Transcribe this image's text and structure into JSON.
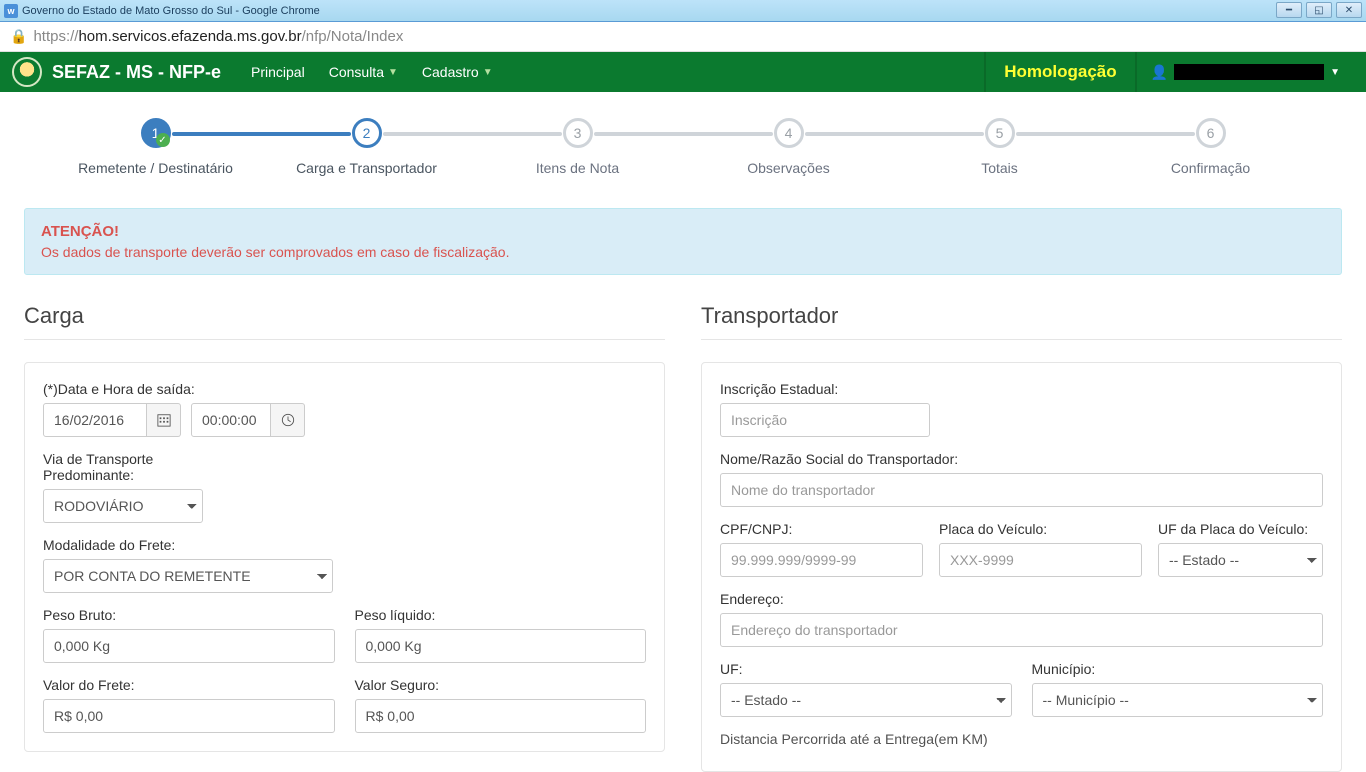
{
  "window": {
    "title": "Governo do Estado de Mato Grosso do Sul - Google Chrome",
    "url_full": "https://hom.servicos.efazenda.ms.gov.br/nfp/Nota/Index",
    "url_scheme": "https://",
    "url_host": "hom.servicos.efazenda.ms.gov.br",
    "url_path": "/nfp/Nota/Index"
  },
  "nav": {
    "brand": "SEFAZ - MS - NFP-e",
    "links": [
      "Principal",
      "Consulta",
      "Cadastro"
    ],
    "env_badge": "Homologação"
  },
  "wizard": {
    "steps": [
      {
        "num": "1",
        "label": "Remetente / Destinatário"
      },
      {
        "num": "2",
        "label": "Carga e Transportador"
      },
      {
        "num": "3",
        "label": "Itens de Nota"
      },
      {
        "num": "4",
        "label": "Observações"
      },
      {
        "num": "5",
        "label": "Totais"
      },
      {
        "num": "6",
        "label": "Confirmação"
      }
    ]
  },
  "alert": {
    "title": "ATENÇÃO!",
    "text": "Os dados de transporte deverão ser comprovados em caso de fiscalização."
  },
  "carga": {
    "title": "Carga",
    "data_hora_label": "(*)Data e Hora de saída:",
    "date_value": "16/02/2016",
    "time_value": "00:00:00",
    "via_label": "Via de Transporte Predominante:",
    "via_value": "RODOVIÁRIO",
    "modalidade_label": "Modalidade do Frete:",
    "modalidade_value": "POR CONTA DO REMETENTE",
    "peso_bruto_label": "Peso Bruto:",
    "peso_bruto_value": "0,000 Kg",
    "peso_liquido_label": "Peso líquido:",
    "peso_liquido_value": "0,000 Kg",
    "valor_frete_label": "Valor do Frete:",
    "valor_frete_value": "R$ 0,00",
    "valor_seguro_label": "Valor Seguro:",
    "valor_seguro_value": "R$ 0,00"
  },
  "transp": {
    "title": "Transportador",
    "inscricao_label": "Inscrição Estadual:",
    "inscricao_ph": "Inscrição",
    "nome_label": "Nome/Razão Social do Transportador:",
    "nome_ph": "Nome do transportador",
    "cpf_label": "CPF/CNPJ:",
    "cpf_ph": "99.999.999/9999-99",
    "placa_label": "Placa do Veículo:",
    "placa_ph": "XXX-9999",
    "uf_placa_label": "UF da Placa do Veículo:",
    "uf_placa_value": "-- Estado --",
    "endereco_label": "Endereço:",
    "endereco_ph": "Endereço do transportador",
    "uf_label": "UF:",
    "uf_value": "-- Estado --",
    "municipio_label": "Município:",
    "municipio_value": "-- Município --",
    "distancia_label": "Distancia Percorrida até a Entrega(em KM)"
  }
}
